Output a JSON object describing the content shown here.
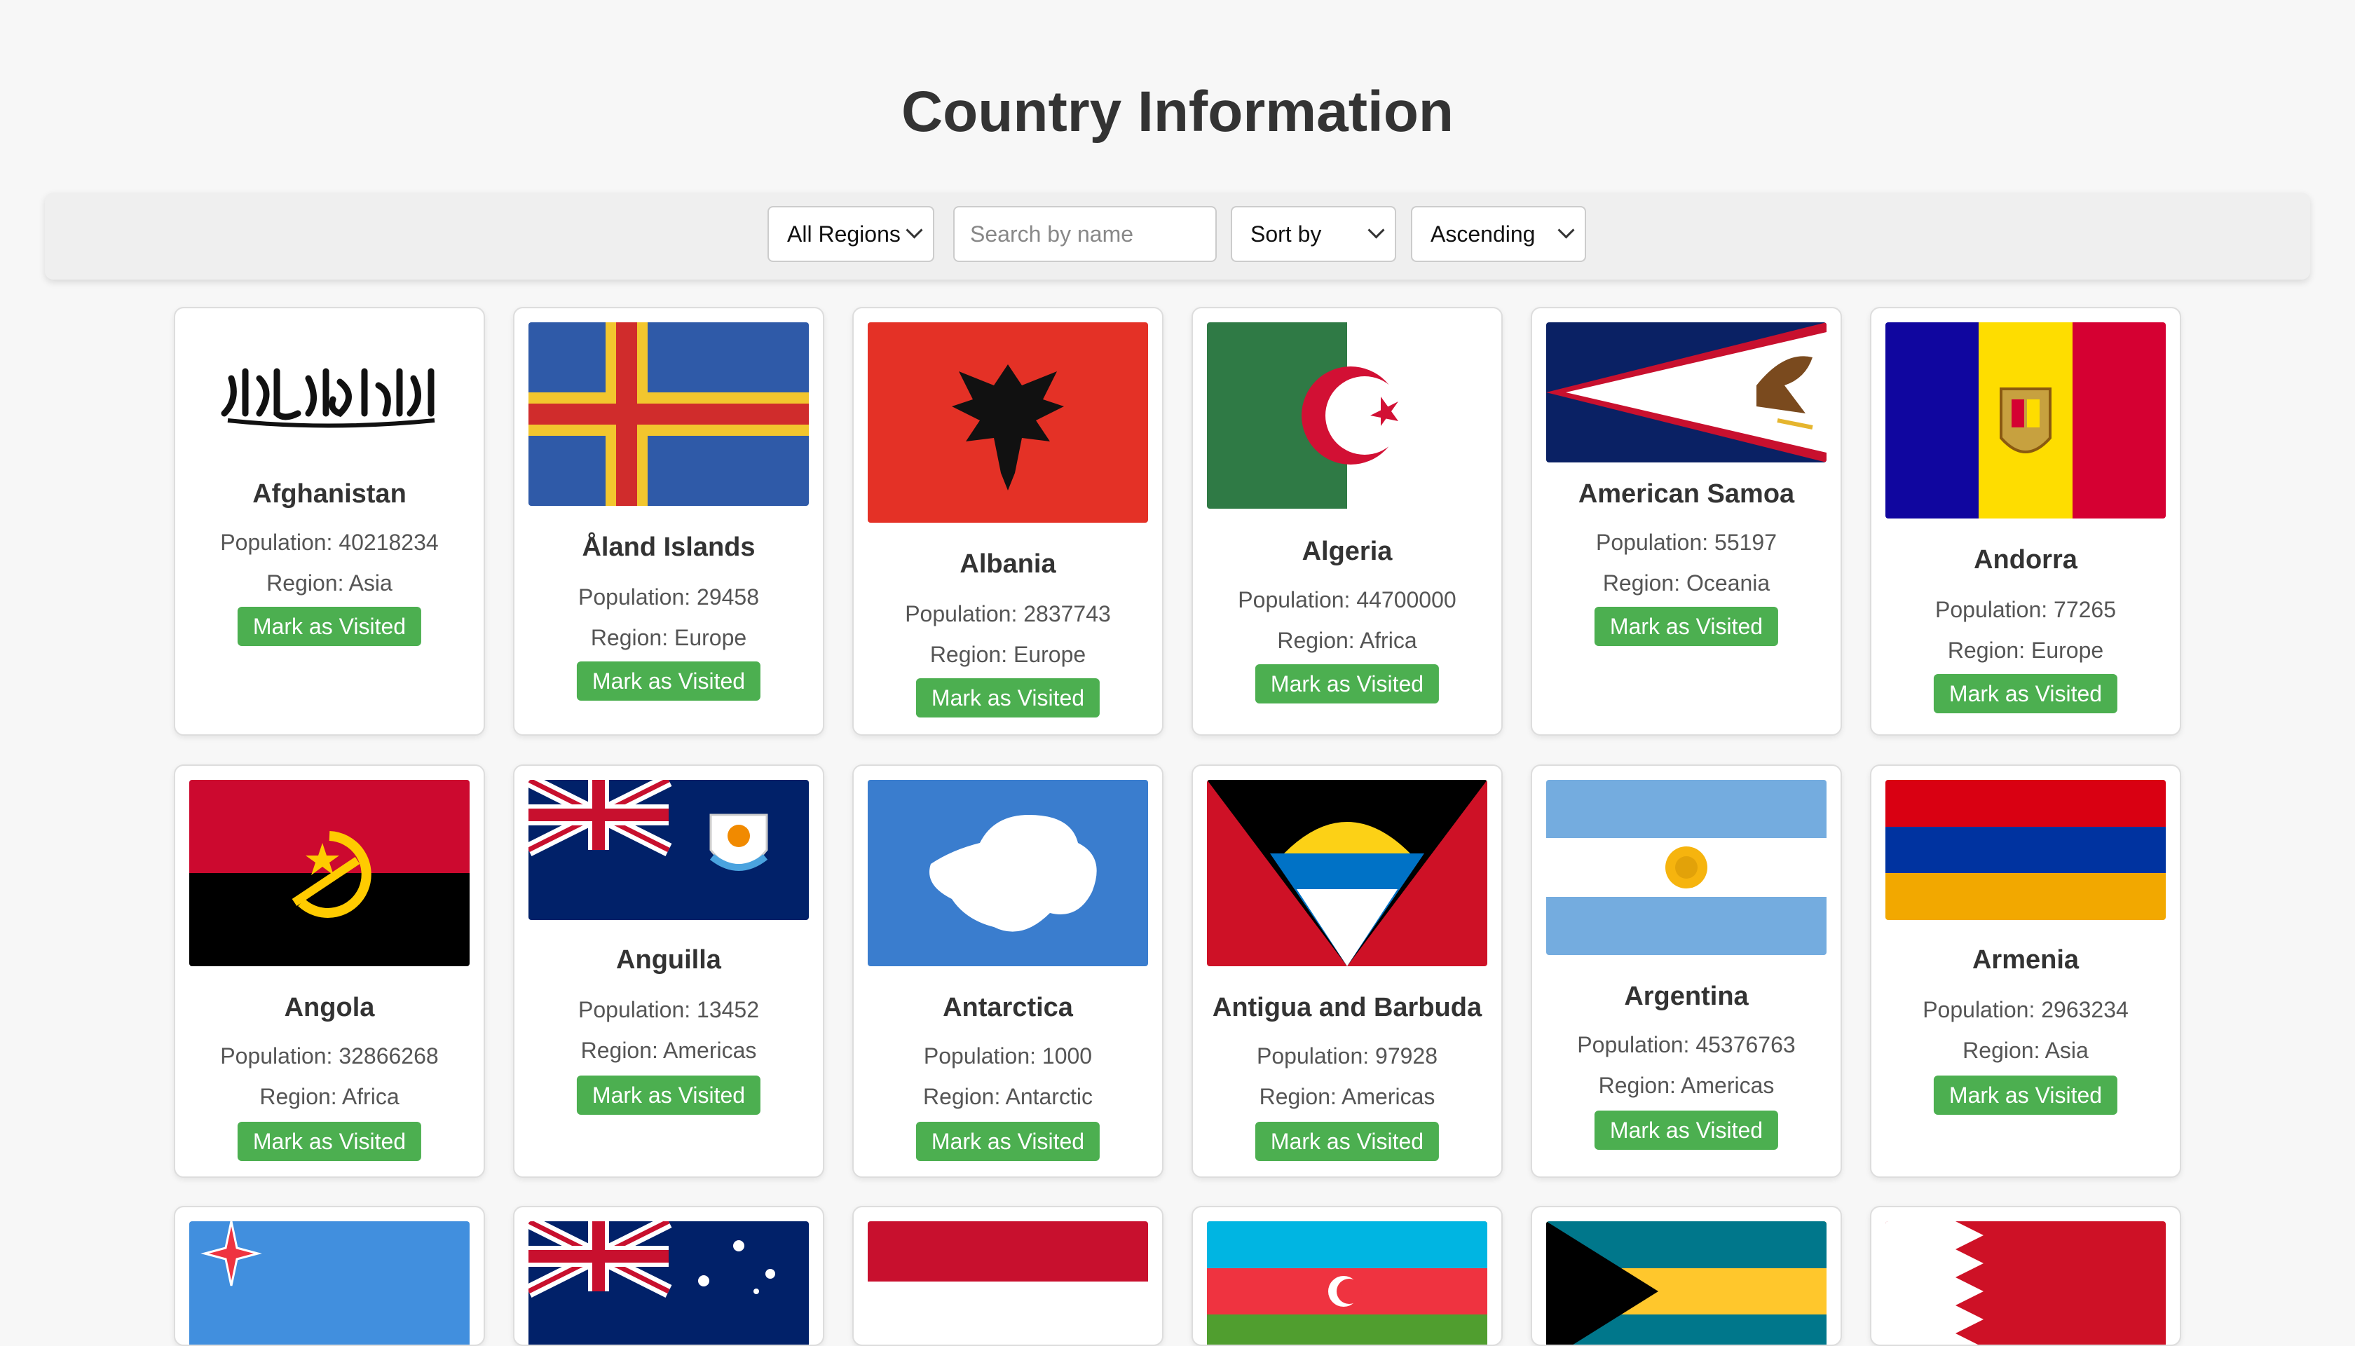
{
  "page": {
    "title": "Country Information"
  },
  "toolbar": {
    "region_select": "All Regions",
    "search_placeholder": "Search by name",
    "sort_select": "Sort by",
    "order_select": "Ascending"
  },
  "button_label": "Mark as Visited",
  "countries": [
    {
      "name": "Afghanistan",
      "population": "Population: 40218234",
      "region": "Region: Asia"
    },
    {
      "name": "Åland Islands",
      "population": "Population: 29458",
      "region": "Region: Europe"
    },
    {
      "name": "Albania",
      "population": "Population: 2837743",
      "region": "Region: Europe"
    },
    {
      "name": "Algeria",
      "population": "Population: 44700000",
      "region": "Region: Africa"
    },
    {
      "name": "American Samoa",
      "population": "Population: 55197",
      "region": "Region: Oceania"
    },
    {
      "name": "Andorra",
      "population": "Population: 77265",
      "region": "Region: Europe"
    },
    {
      "name": "Angola",
      "population": "Population: 32866268",
      "region": "Region: Africa"
    },
    {
      "name": "Anguilla",
      "population": "Population: 13452",
      "region": "Region: Americas"
    },
    {
      "name": "Antarctica",
      "population": "Population: 1000",
      "region": "Region: Antarctic"
    },
    {
      "name": "Antigua and Barbuda",
      "population": "Population: 97928",
      "region": "Region: Americas"
    },
    {
      "name": "Argentina",
      "population": "Population: 45376763",
      "region": "Region: Americas"
    },
    {
      "name": "Armenia",
      "population": "Population: 2963234",
      "region": "Region: Asia"
    }
  ],
  "colors": {
    "button": "#4caf50",
    "background": "#f7f7f7"
  }
}
